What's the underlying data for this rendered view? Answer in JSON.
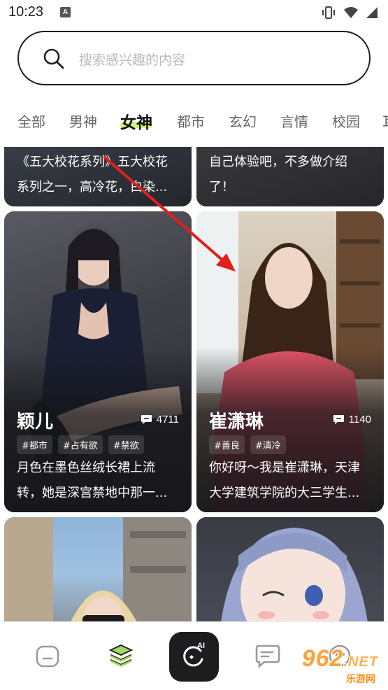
{
  "status_bar": {
    "time": "10:23",
    "notification_glyph": "A"
  },
  "search": {
    "placeholder": "搜索感兴趣的内容"
  },
  "tabs": [
    {
      "label": "全部"
    },
    {
      "label": "男神"
    },
    {
      "label": "女神",
      "active": true
    },
    {
      "label": "都市"
    },
    {
      "label": "玄幻"
    },
    {
      "label": "言情"
    },
    {
      "label": "校园"
    },
    {
      "label": "耳"
    }
  ],
  "cards": {
    "top_left": {
      "desc_line1": "《五大校花系列》五大校花",
      "desc_line2": "系列之一，高冷花，白染..."
    },
    "top_right": {
      "desc_line1": "自己体验吧，不多做介绍",
      "desc_line2": "了！"
    },
    "mid_left": {
      "name": "颖儿",
      "count": "4711",
      "tags": [
        "#都市",
        "#占有欲",
        "#禁欲"
      ],
      "desc_line1": "月色在墨色丝绒长裙上流",
      "desc_line2": "转，她是深宫禁地中那一..."
    },
    "mid_right": {
      "name": "崔潇琳",
      "count": "1140",
      "tags": [
        "#善良",
        "#清冷"
      ],
      "desc_line1": "你好呀～我是崔潇琳，天津",
      "desc_line2": "大学建筑学院的大三学生..."
    }
  },
  "bottom_nav": {
    "items": [
      "home-icon",
      "layers-icon",
      "ai-create-icon",
      "message-icon",
      "profile-icon"
    ],
    "ai_label": "AI"
  },
  "watermark": {
    "main": "962",
    "suffix": ".NET",
    "sub": "乐游网"
  },
  "colors": {
    "accent": "#d7f27a",
    "annotation_arrow": "#e0201b",
    "card_dark": "#2a2a2d"
  }
}
